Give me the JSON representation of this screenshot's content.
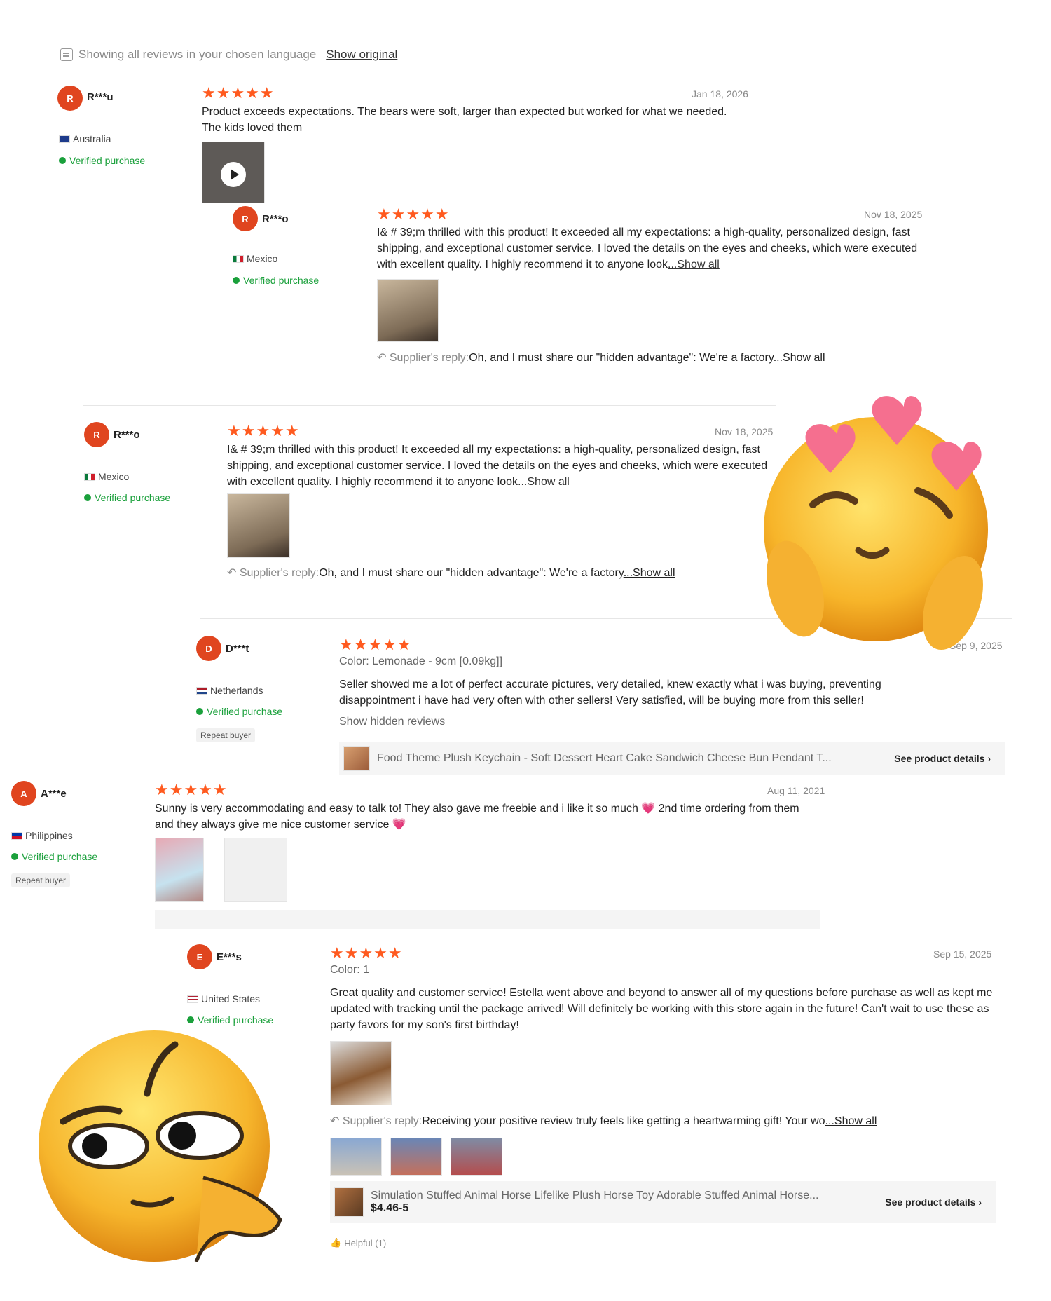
{
  "header": {
    "language_note": "Showing all reviews in your chosen language",
    "show_original": "Show original"
  },
  "reviews": [
    {
      "avatar_letter": "R",
      "user": "R***u",
      "country": "Australia",
      "verified": "Verified purchase",
      "stars": "★★★★★",
      "date": "Jan 18, 2026",
      "text": "Product exceeds expectations. The bears were soft, larger than expected but worked for what we needed. The kids loved them"
    },
    {
      "avatar_letter": "R",
      "user": "R***o",
      "country": "Mexico",
      "verified": "Verified purchase",
      "stars": "★★★★★",
      "date": "Nov 18, 2025",
      "text": "I& # 39;m thrilled with this product! It exceeded all my expectations: a high-quality, personalized design, fast shipping, and exceptional customer service. I loved the details on the eyes and cheeks, which were executed with excellent quality. I highly recommend it to anyone look",
      "show_all": "...Show all",
      "reply_label": "Supplier's reply:",
      "reply_text": "Oh, and I must share our \"hidden advantage\": We're a factory",
      "reply_show_all": "...Show all"
    },
    {
      "avatar_letter": "R",
      "user": "R***o",
      "country": "Mexico",
      "verified": "Verified purchase",
      "stars": "★★★★★",
      "date": "Nov 18, 2025",
      "text": "I& # 39;m thrilled with this product! It exceeded all my expectations: a high-quality, personalized design, fast shipping, and exceptional customer service. I loved the details on the eyes and cheeks, which were executed with excellent quality. I highly recommend it to anyone look",
      "show_all": "...Show all",
      "reply_label": "Supplier's reply:",
      "reply_text": "Oh, and I must share our \"hidden advantage\": We're a factory",
      "reply_show_all": "...Show all"
    },
    {
      "avatar_letter": "D",
      "user": "D***t",
      "country": "Netherlands",
      "verified": "Verified purchase",
      "repeat": "Repeat buyer",
      "stars": "★★★★★",
      "date": "Sep 9, 2025",
      "color_line": "Color:  Lemonade - 9cm [0.09kg]]",
      "text": "Seller showed me a lot of perfect accurate pictures, very detailed, knew exactly what i was buying, preventing disappointment i have had very often with other sellers! Very satisfied, will be buying more from this seller!",
      "hidden_link": "Show hidden reviews",
      "product_title": "Food Theme Plush Keychain - Soft Dessert Heart Cake Sandwich Cheese Bun Pendant T...",
      "see_details": "See product details ›"
    },
    {
      "avatar_letter": "A",
      "user": "A***e",
      "country": "Philippines",
      "verified": "Verified purchase",
      "repeat": "Repeat buyer",
      "stars": "★★★★★",
      "date": "Aug 11, 2021",
      "text": "Sunny is very accommodating and easy to talk to! They also gave me freebie and i like it so much 💗 2nd time ordering from them and they always give me nice customer service 💗"
    },
    {
      "avatar_letter": "E",
      "user": "E***s",
      "country": "United States",
      "verified": "Verified purchase",
      "stars": "★★★★★",
      "date": "Sep 15, 2025",
      "color_line": "Color:  1",
      "text": "Great quality and customer service! Estella went above and beyond to answer all of my questions before purchase as well as kept me updated with tracking until the package arrived! Will definitely be working with this store again in the future! Can't wait to use these as party favors for my son's first birthday!",
      "reply_label": "Supplier's reply:",
      "reply_text": "Receiving your positive review truly feels like getting a heartwarming gift! Your wo",
      "reply_show_all": "...Show all",
      "product_title": "Simulation Stuffed Animal Horse Lifelike Plush Horse Toy Adorable Stuffed Animal Horse...",
      "price": "$4.46-5",
      "see_details": "See product details ›",
      "helpful": "Helpful (1)"
    }
  ],
  "colors": {
    "accent": "#ff5a1f",
    "avatar": "#e0451f",
    "verified": "#1aa03b"
  },
  "stickers": [
    "smiling-face-with-hearts-emoji",
    "smirking-side-eye-emoji"
  ]
}
